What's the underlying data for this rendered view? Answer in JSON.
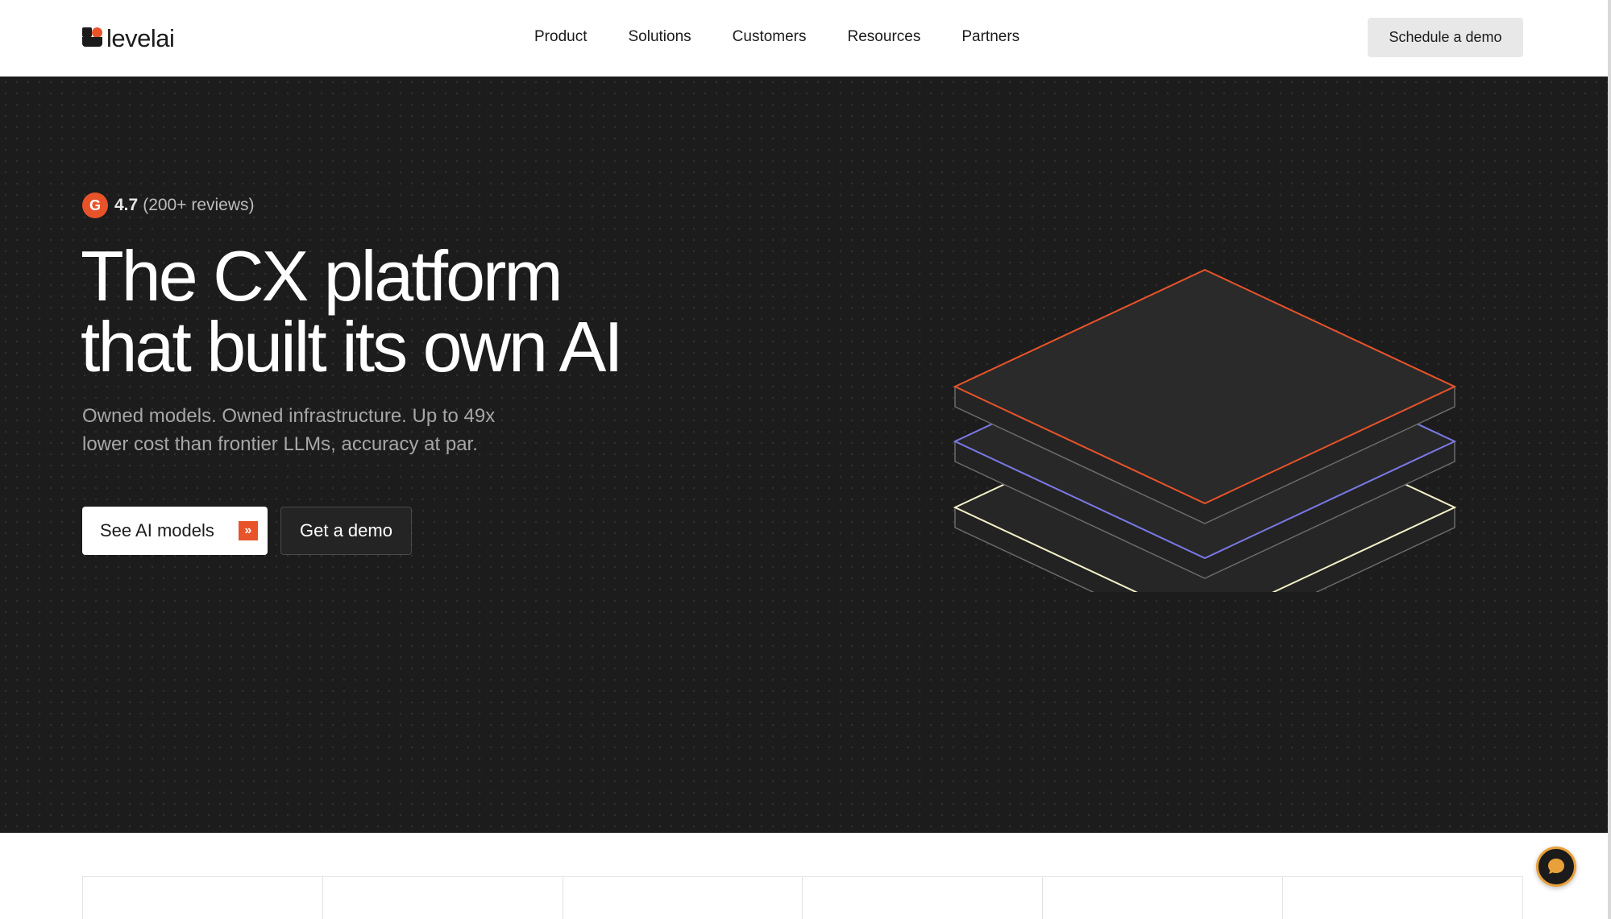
{
  "brand": {
    "name": "levelai"
  },
  "nav": {
    "links": [
      "Product",
      "Solutions",
      "Customers",
      "Resources",
      "Partners"
    ],
    "cta": "Schedule a demo"
  },
  "hero": {
    "rating": {
      "score": "4.7",
      "count": "(200+ reviews)",
      "badge": "G"
    },
    "headline_line1": "The CX platform",
    "headline_line2": "that built its own AI",
    "subhead_line1": "Owned models. Owned infrastructure. Up to 49x",
    "subhead_line2": "lower cost than frontier LLMs, accuracy at par.",
    "primary_button": "See AI models",
    "secondary_button": "Get a demo"
  },
  "colors": {
    "accent": "#e8532a",
    "hero_bg": "#1c1c1c",
    "layer_top": "#e8532a",
    "layer_middle": "#7b78e6",
    "layer_bottom": "#f3efc8"
  },
  "icons": {
    "logo": "levelai-logo-mark",
    "rating": "g2-badge-icon",
    "arrow": "double-chevron-right-icon",
    "chat": "chat-bubble-icon"
  }
}
